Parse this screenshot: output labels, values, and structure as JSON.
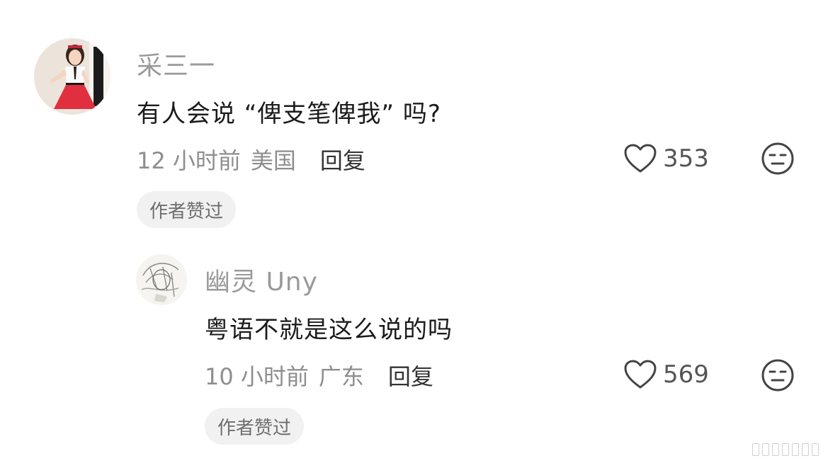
{
  "comments": [
    {
      "username": "采三一",
      "text": "有人会说 “俾支笔俾我” 吗?",
      "time": "12 小时前",
      "location": "美国",
      "reply_label": "回复",
      "likes": "353",
      "badge": "作者赞过",
      "avatar_icon": "doll-avatar"
    },
    {
      "username": "幽灵 Uny",
      "text": "粤语不就是这么说的吗",
      "time": "10 小时前",
      "location": "广东",
      "reply_label": "回复",
      "likes": "569",
      "badge": "作者赞过",
      "avatar_icon": "sketch-avatar"
    }
  ],
  "icons": {
    "like": "heart-icon",
    "dislike": "meh-face-icon"
  },
  "colors": {
    "username": "#9a9a9a",
    "text": "#1b1b1b",
    "meta": "#8e8e8e",
    "badge_bg": "#f1f1f1"
  }
}
